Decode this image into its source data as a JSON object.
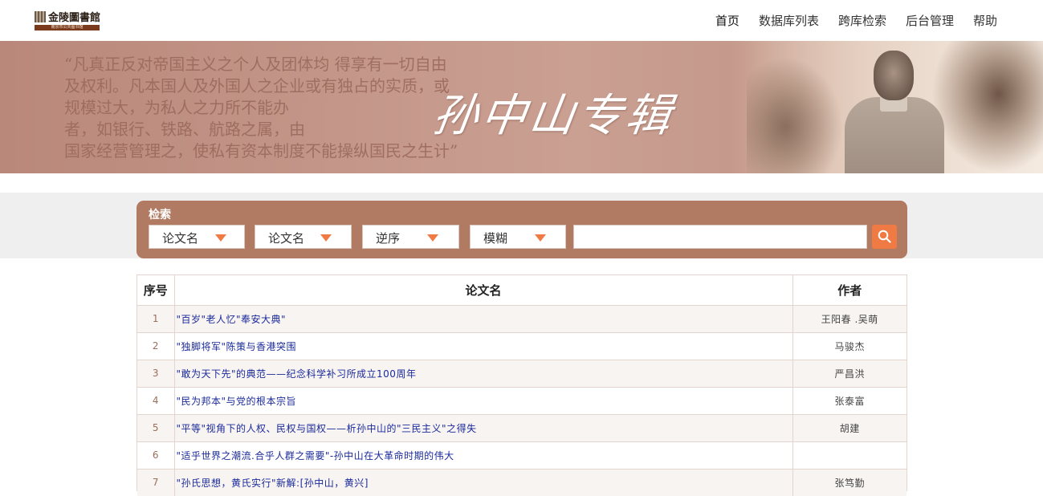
{
  "header": {
    "logo_name": "金陵圖書館",
    "logo_subtitle": "南京市公共图书馆",
    "nav": [
      {
        "label": "首页"
      },
      {
        "label": "数据库列表"
      },
      {
        "label": "跨库检索"
      },
      {
        "label": "后台管理"
      },
      {
        "label": "帮助"
      }
    ]
  },
  "banner": {
    "quote_lines": [
      "“凡真正反对帝国主义之个人及团体均 得享有一切自由",
      "及权利。凡本国人及外国人之企业或有独占的实质，或",
      "规模过大，为私人之力所不能办",
      "者，如银行、铁路、航路之属，由",
      "国家经营管理之，使私有资本制度不能操纵国民之生计”"
    ],
    "calligraphy": "孙中山专辑"
  },
  "search": {
    "title": "检索",
    "field1": "论文名",
    "field2": "论文名",
    "order": "逆序",
    "match": "模糊",
    "input_value": "",
    "accent_color": "#f07a44",
    "panel_color": "#b17a62"
  },
  "table": {
    "headers": {
      "no": "序号",
      "name": "论文名",
      "author": "作者"
    },
    "rows": [
      {
        "no": "1",
        "name": "\"百岁\"老人忆\"奉安大典\"",
        "author": "王阳春 .吴萌"
      },
      {
        "no": "2",
        "name": "\"独脚将军\"陈策与香港突围",
        "author": "马骏杰"
      },
      {
        "no": "3",
        "name": "\"敢为天下先\"的典范——纪念科学补习所成立100周年",
        "author": "严昌洪"
      },
      {
        "no": "4",
        "name": "\"民为邦本\"与党的根本宗旨",
        "author": "张泰富"
      },
      {
        "no": "5",
        "name": "\"平等\"视角下的人权、民权与国权——析孙中山的\"三民主义\"之得失",
        "author": "胡建"
      },
      {
        "no": "6",
        "name": "\"适乎世界之潮流.合乎人群之需要\"-孙中山在大革命时期的伟大",
        "author": ""
      },
      {
        "no": "7",
        "name": "\"孙氏思想，黄氏实行\"新解:[孙中山，黄兴]",
        "author": "张笃勤"
      }
    ]
  }
}
